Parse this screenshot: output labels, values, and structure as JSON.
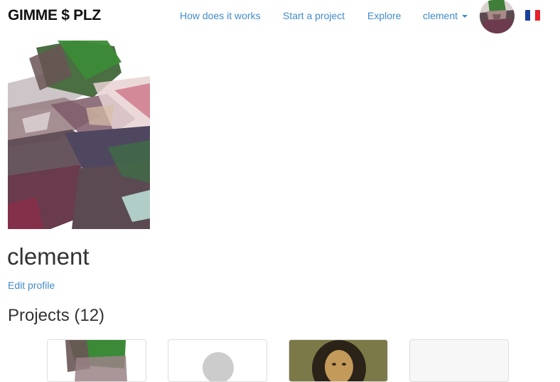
{
  "navbar": {
    "brand": "GIMME $ PLZ",
    "links": [
      {
        "label": "How does it works"
      },
      {
        "label": "Start a project"
      },
      {
        "label": "Explore"
      }
    ],
    "user_menu": {
      "label": "clement"
    },
    "language_icon": "french-flag-icon"
  },
  "profile": {
    "name": "clement",
    "edit_label": "Edit profile",
    "projects_heading": "Projects (12)"
  },
  "colors": {
    "link": "#428bca",
    "text": "#333333",
    "flag_blue": "#1a3f9c",
    "flag_white": "#ffffff",
    "flag_red": "#e8202a"
  }
}
